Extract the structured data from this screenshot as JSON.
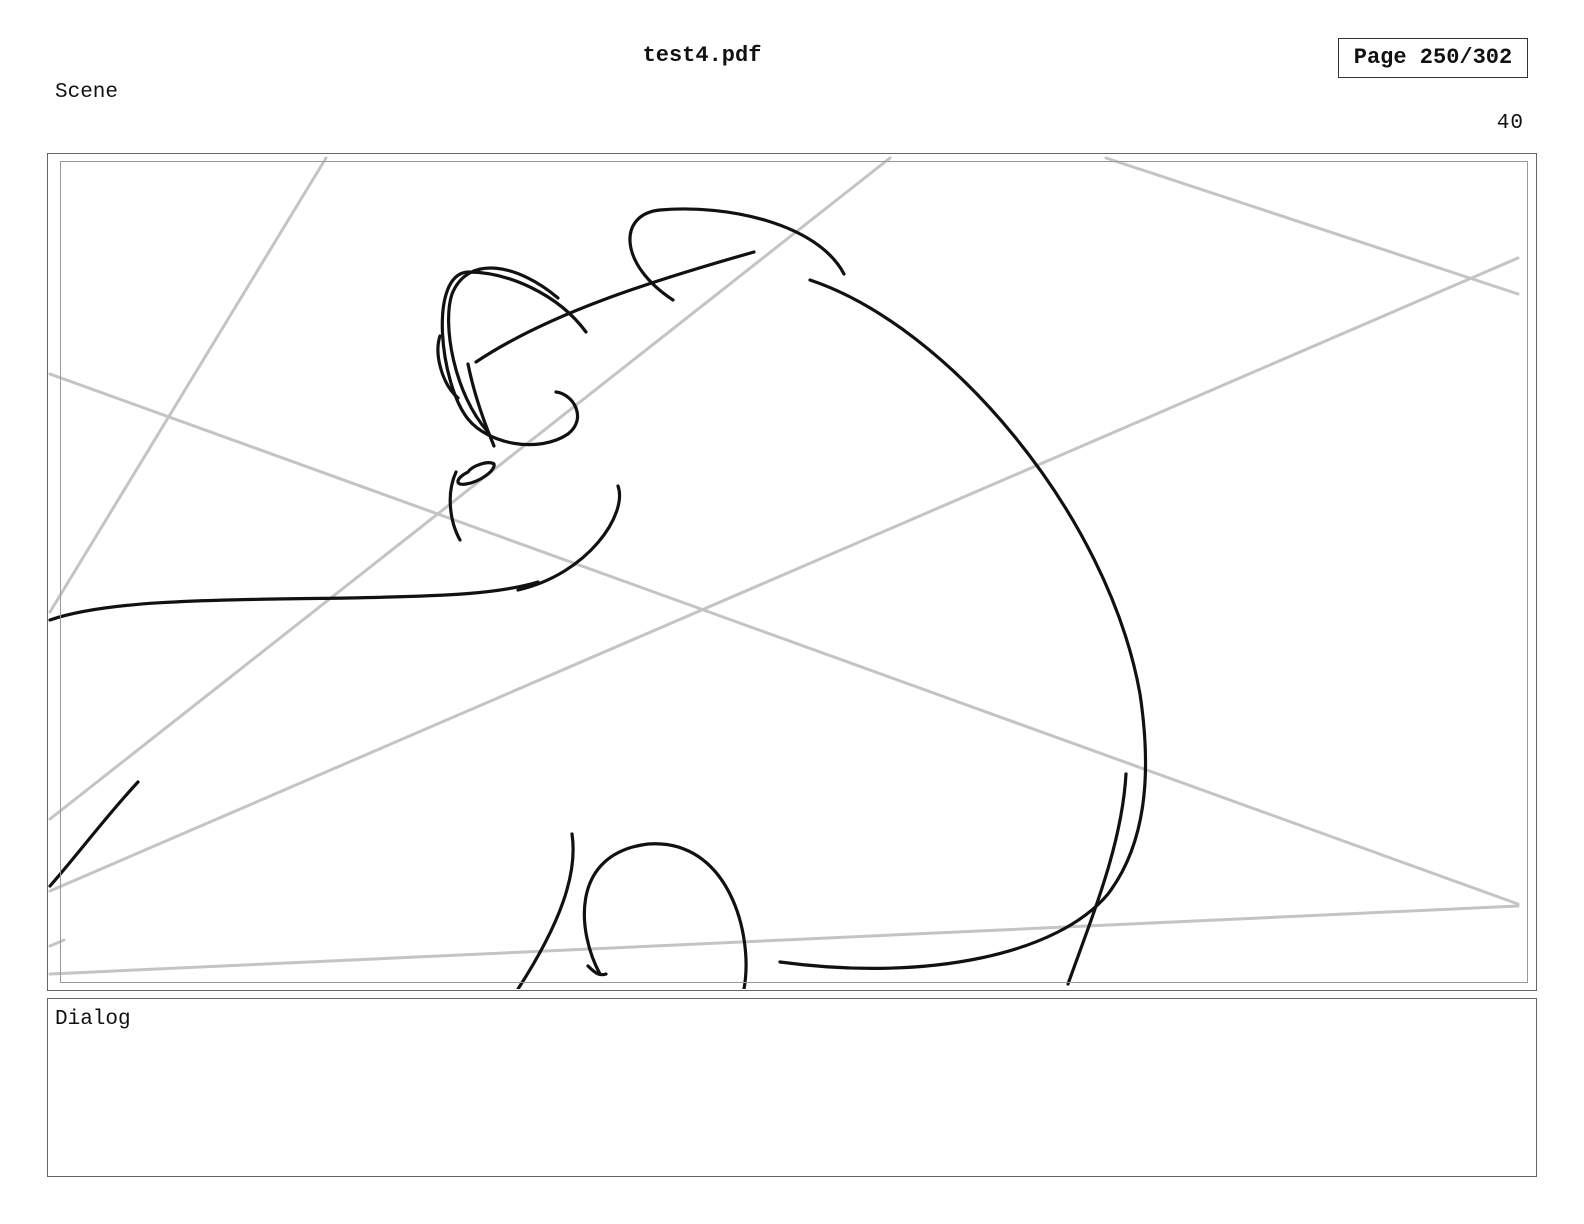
{
  "header": {
    "title": "test4.pdf",
    "page_indicator": "Page 250/302"
  },
  "scene": {
    "label": "Scene",
    "panel_number": "40"
  },
  "panel": {
    "image": "storyboard-sketch",
    "line_color": "#111111",
    "guide_color": "#c4c4c4"
  },
  "dialog": {
    "label": "Dialog",
    "text": ""
  }
}
